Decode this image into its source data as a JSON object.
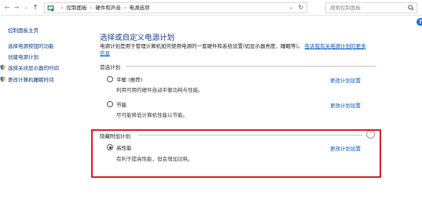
{
  "address_bar": {
    "back_icon": "back-arrow-icon",
    "forward_icon": "forward-arrow-icon",
    "recent_icon": "chevron-down-icon",
    "up_icon": "up-arrow-icon",
    "location_icon": "control-panel-icon",
    "breadcrumbs": [
      "控制面板",
      "硬件和声音",
      "电源选项"
    ],
    "separator": "›",
    "dropdown_glyph": "⌄",
    "refresh_glyph": "↻"
  },
  "search": {
    "placeholder": "搜索控制面板",
    "icon": "search-icon"
  },
  "help": {
    "label": "?"
  },
  "left_nav": {
    "home": "控制面板主页",
    "links": [
      "选择电源按钮的功能",
      "创建电源计划",
      "选择关闭显示器的时间",
      "更改计算机睡眠时间"
    ]
  },
  "main": {
    "title": "选择或自定义电源计划",
    "description": "电源计划是用于管理计算机如何使用电源的一套硬件和系统设置(如显示器亮度、睡眠等)。",
    "description_link": "告诉我有关电源计划的更多信息",
    "preferred_section": "首选计划",
    "hidden_section": "隐藏附加计划",
    "collapse_glyph": "⌃",
    "plans": [
      {
        "name": "平衡 (推荐)",
        "desc": "利用可用的硬件自动平衡功耗与性能。",
        "link": "更改计划设置",
        "selected": false
      },
      {
        "name": "节能",
        "desc": "尽可能降低计算机性能以节能。",
        "link": "更改计划设置",
        "selected": false
      },
      {
        "name": "高性能",
        "desc": "有利于提高性能，但会增加功耗。",
        "link": "更改计划设置",
        "selected": true
      }
    ]
  },
  "colors": {
    "title": "#1a3b8e",
    "link": "#0a55c4",
    "nav_link": "#0a3b87",
    "highlight": "#d61f26",
    "help": "#1a73d9"
  }
}
